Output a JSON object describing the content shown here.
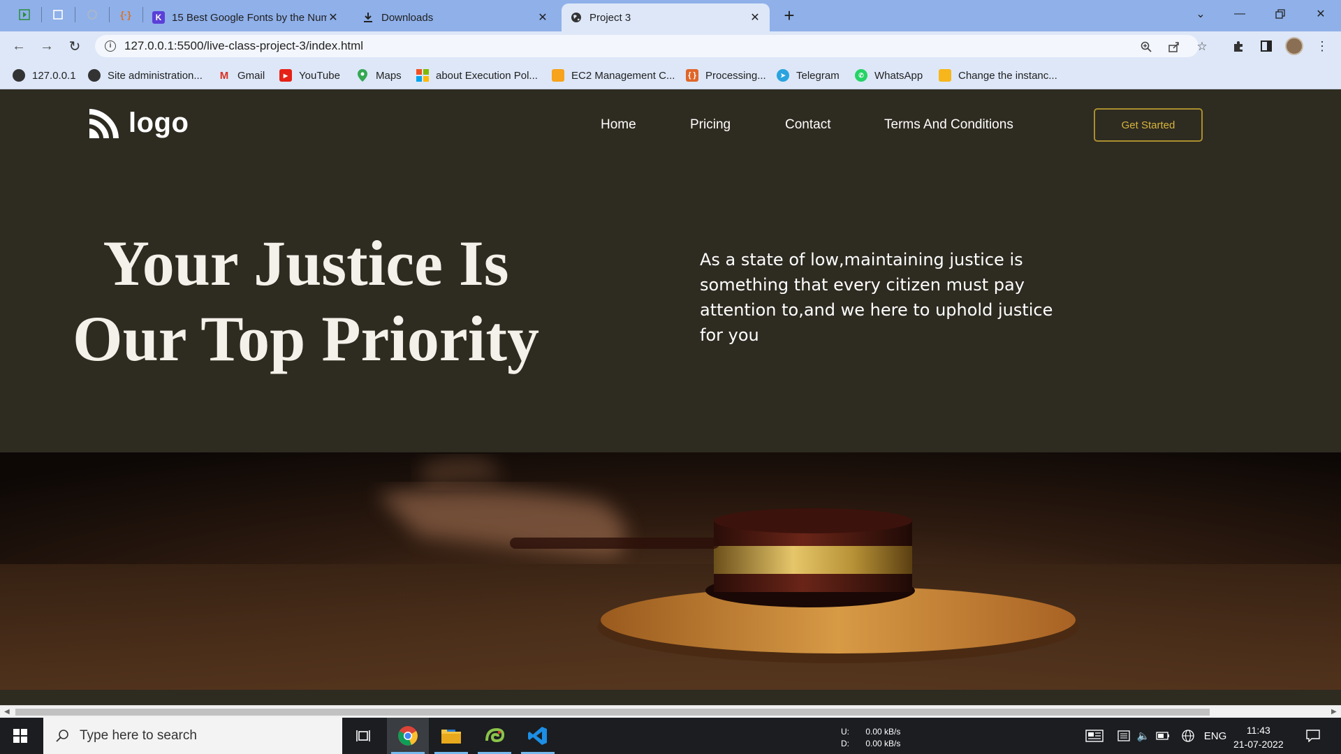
{
  "browser": {
    "tabs": [
      {
        "label": "15 Best Google Fonts by the Num",
        "icon": "k-icon",
        "active": false
      },
      {
        "label": "Downloads",
        "icon": "download-icon",
        "active": false
      },
      {
        "label": "Project 3",
        "icon": "globe-icon",
        "active": true
      }
    ],
    "url": "127.0.0.1:5500/live-class-project-3/index.html",
    "bookmarks": [
      {
        "label": "127.0.0.1",
        "icon": "globe-icon"
      },
      {
        "label": "Site administration...",
        "icon": "globe-icon"
      },
      {
        "label": "Gmail",
        "icon": "gmail-icon"
      },
      {
        "label": "YouTube",
        "icon": "youtube-icon"
      },
      {
        "label": "Maps",
        "icon": "maps-icon"
      },
      {
        "label": "about Execution Pol...",
        "icon": "windows-icon"
      },
      {
        "label": "EC2 Management C...",
        "icon": "aws-icon"
      },
      {
        "label": "Processing...",
        "icon": "processing-icon"
      },
      {
        "label": "Telegram",
        "icon": "telegram-icon"
      },
      {
        "label": "WhatsApp",
        "icon": "whatsapp-icon"
      },
      {
        "label": "Change the instanc...",
        "icon": "aws-icon"
      }
    ]
  },
  "site": {
    "logo_text": "logo",
    "nav": [
      "Home",
      "Pricing",
      "Contact",
      "Terms And Conditions"
    ],
    "cta_label": "Get Started",
    "hero": {
      "title_line1": "Your Justice Is",
      "title_line2": "Our Top Priority",
      "text": "As a state of low,maintaining justice is something that every citizen must pay attention to,and we here to uphold justice for you"
    }
  },
  "taskbar": {
    "search_placeholder": "Type here to search",
    "net_up_label": "U:",
    "net_up_value": "0.00 kB/s",
    "net_down_label": "D:",
    "net_down_value": "0.00 kB/s",
    "language": "ENG",
    "time": "11:43",
    "date": "21-07-2022"
  },
  "colors": {
    "page_background": "#2e2b21",
    "accent_gold": "#d8b53d",
    "tab_strip": "#8fb0e9",
    "toolbar": "#dde7f8"
  }
}
